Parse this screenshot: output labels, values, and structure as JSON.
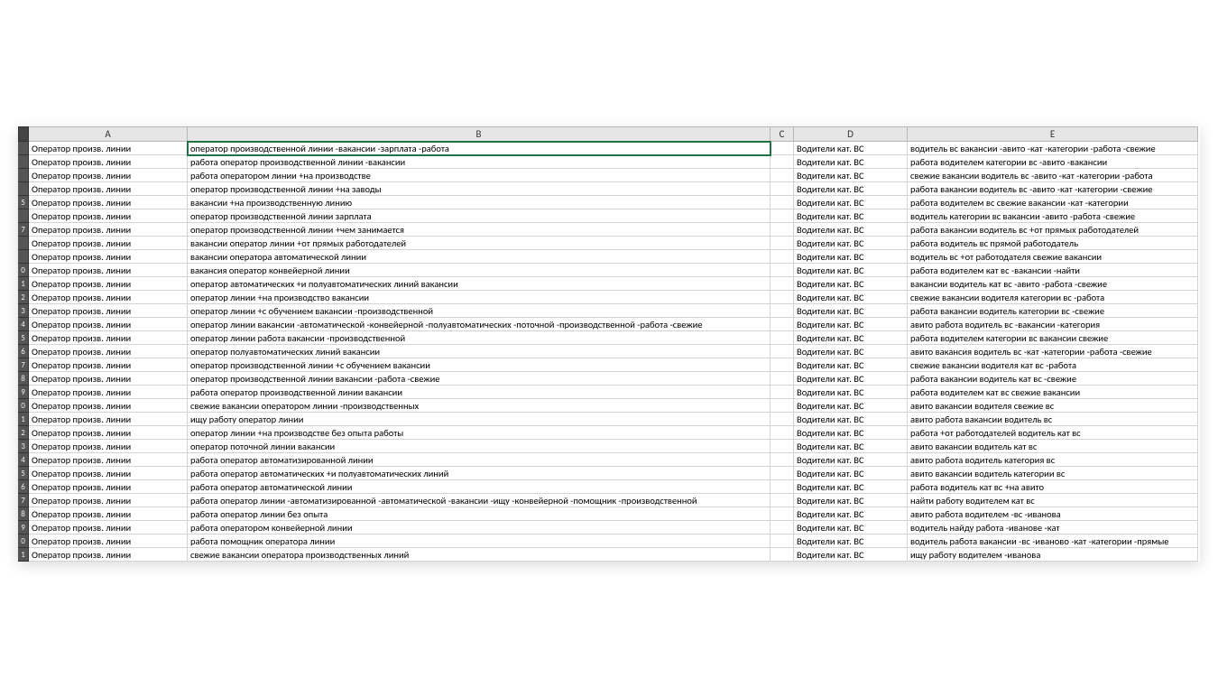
{
  "columns": [
    "A",
    "B",
    "C",
    "D",
    "E"
  ],
  "rows": [
    {
      "n": "",
      "A": "Оператор произв. линии",
      "B": "оператор производственной линии -вакансии -зарплата -работа",
      "C": "",
      "D": "Водители кат. BC",
      "E": "водитель вс вакансии -авито -кат -категории -работа -свежие"
    },
    {
      "n": "",
      "A": "Оператор произв. линии",
      "B": "работа оператор производственной линии -вакансии",
      "C": "",
      "D": "Водители кат. BC",
      "E": "работа водителем категории вс -авито -вакансии"
    },
    {
      "n": "",
      "A": "Оператор произв. линии",
      "B": "работа оператором линии +на производстве",
      "C": "",
      "D": "Водители кат. BC",
      "E": "свежие вакансии водитель вс -авито -кат -категории -работа"
    },
    {
      "n": "",
      "A": "Оператор произв. линии",
      "B": "оператор производственной линии +на заводы",
      "C": "",
      "D": "Водители кат. BC",
      "E": "работа вакансии водитель вс -авито -кат -категории -свежие"
    },
    {
      "n": "5",
      "A": "Оператор произв. линии",
      "B": "вакансии +на производственную линию",
      "C": "",
      "D": "Водители кат. BC",
      "E": "работа водителем вс свежие вакансии -кат -категории"
    },
    {
      "n": "",
      "A": "Оператор произв. линии",
      "B": "оператор производственной линии зарплата",
      "C": "",
      "D": "Водители кат. BC",
      "E": "водитель категории вс вакансии -авито -работа -свежие"
    },
    {
      "n": "7",
      "A": "Оператор произв. линии",
      "B": "оператор производственной линии +чем занимается",
      "C": "",
      "D": "Водители кат. BC",
      "E": "работа вакансии водитель вс +от прямых работодателей"
    },
    {
      "n": "",
      "A": "Оператор произв. линии",
      "B": "вакансии оператор линии +от прямых работодателей",
      "C": "",
      "D": "Водители кат. BC",
      "E": "работа водитель вс прямой работодатель"
    },
    {
      "n": "",
      "A": "Оператор произв. линии",
      "B": "вакансии оператора автоматической линии",
      "C": "",
      "D": "Водители кат. BC",
      "E": "водитель вс +от работодателя свежие вакансии"
    },
    {
      "n": "0",
      "A": "Оператор произв. линии",
      "B": "вакансия оператор конвейерной линии",
      "C": "",
      "D": "Водители кат. BC",
      "E": "работа водителем кат вс -вакансии -найти"
    },
    {
      "n": "1",
      "A": "Оператор произв. линии",
      "B": "оператор автоматических +и полуавтоматических линий вакансии",
      "C": "",
      "D": "Водители кат. BC",
      "E": "вакансии водитель кат вс -авито -работа -свежие"
    },
    {
      "n": "2",
      "A": "Оператор произв. линии",
      "B": "оператор линии +на производство вакансии",
      "C": "",
      "D": "Водители кат. BC",
      "E": "свежие вакансии водителя категории вс -работа"
    },
    {
      "n": "3",
      "A": "Оператор произв. линии",
      "B": "оператор линии +с обучением вакансии -производственной",
      "C": "",
      "D": "Водители кат. BC",
      "E": "работа вакансии водитель категории вс -свежие"
    },
    {
      "n": "4",
      "A": "Оператор произв. линии",
      "B": "оператор линии вакансии -автоматической -конвейерной -полуавтоматических -поточной -производственной -работа -свежие",
      "C": "",
      "D": "Водители кат. BC",
      "E": "авито работа водитель вс -вакансии -категория"
    },
    {
      "n": "5",
      "A": "Оператор произв. линии",
      "B": "оператор линии работа вакансии -производственной",
      "C": "",
      "D": "Водители кат. BC",
      "E": "работа водителем категории вс вакансии свежие"
    },
    {
      "n": "6",
      "A": "Оператор произв. линии",
      "B": "оператор полуавтоматических линий вакансии",
      "C": "",
      "D": "Водители кат. BC",
      "E": "авито вакансия водитель вс -кат -категории -работа -свежие"
    },
    {
      "n": "7",
      "A": "Оператор произв. линии",
      "B": "оператор производственной линии +с обучением вакансии",
      "C": "",
      "D": "Водители кат. BC",
      "E": "свежие вакансии водителя кат вс -работа"
    },
    {
      "n": "8",
      "A": "Оператор произв. линии",
      "B": "оператор производственной линии вакансии -работа -свежие",
      "C": "",
      "D": "Водители кат. BC",
      "E": "работа вакансии водитель кат вс -свежие"
    },
    {
      "n": "9",
      "A": "Оператор произв. линии",
      "B": "работа оператор производственной линии вакансии",
      "C": "",
      "D": "Водители кат. BC",
      "E": "работа водителем кат вс свежие вакансии"
    },
    {
      "n": "0",
      "A": "Оператор произв. линии",
      "B": "свежие вакансии оператором линии -производственных",
      "C": "",
      "D": "Водители кат. BC",
      "E": "авито вакансии водителя свежие вс"
    },
    {
      "n": "1",
      "A": "Оператор произв. линии",
      "B": "ищу работу оператор линии",
      "C": "",
      "D": "Водители кат. BC",
      "E": "авито работа вакансии водитель вс"
    },
    {
      "n": "2",
      "A": "Оператор произв. линии",
      "B": "оператор линии +на производстве без опыта работы",
      "C": "",
      "D": "Водители кат. BC",
      "E": "работа +от работодателей водитель кат вс"
    },
    {
      "n": "3",
      "A": "Оператор произв. линии",
      "B": "оператор поточной линии вакансии",
      "C": "",
      "D": "Водители кат. BC",
      "E": "авито вакансии водитель кат вс"
    },
    {
      "n": "4",
      "A": "Оператор произв. линии",
      "B": "работа оператор автоматизированной линии",
      "C": "",
      "D": "Водители кат. BC",
      "E": "авито работа водитель категория вс"
    },
    {
      "n": "5",
      "A": "Оператор произв. линии",
      "B": "работа оператор автоматических +и полуавтоматических линий",
      "C": "",
      "D": "Водители кат. BC",
      "E": "авито вакансии водитель категории вс"
    },
    {
      "n": "6",
      "A": "Оператор произв. линии",
      "B": "работа оператор автоматической линии",
      "C": "",
      "D": "Водители кат. BC",
      "E": "работа водитель кат вс +на авито"
    },
    {
      "n": "7",
      "A": "Оператор произв. линии",
      "B": "работа оператор линии -автоматизированной -автоматической -вакансии -ищу -конвейерной -помощник -производственной",
      "C": "",
      "D": "Водители кат. BC",
      "E": "найти работу водителем кат вс"
    },
    {
      "n": "8",
      "A": "Оператор произв. линии",
      "B": "работа оператор линии без опыта",
      "C": "",
      "D": "Водители кат. BC",
      "E": "авито работа водителем -вс -иванова"
    },
    {
      "n": "9",
      "A": "Оператор произв. линии",
      "B": "работа оператором конвейерной линии",
      "C": "",
      "D": "Водители кат. BC",
      "E": "водитель найду работа -иванове -кат"
    },
    {
      "n": "0",
      "A": "Оператор произв. линии",
      "B": "работа помощник оператора линии",
      "C": "",
      "D": "Водители кат. BC",
      "E": "водитель работа вакансии -вс -иваново -кат -категории -прямые"
    },
    {
      "n": "1",
      "A": "Оператор произв. линии",
      "B": "свежие вакансии оператора производственных линий",
      "C": "",
      "D": "Водители кат. BC",
      "E": "ищу работу водителем -иванова"
    }
  ],
  "active_cell": {
    "row": 0,
    "col": "B"
  }
}
